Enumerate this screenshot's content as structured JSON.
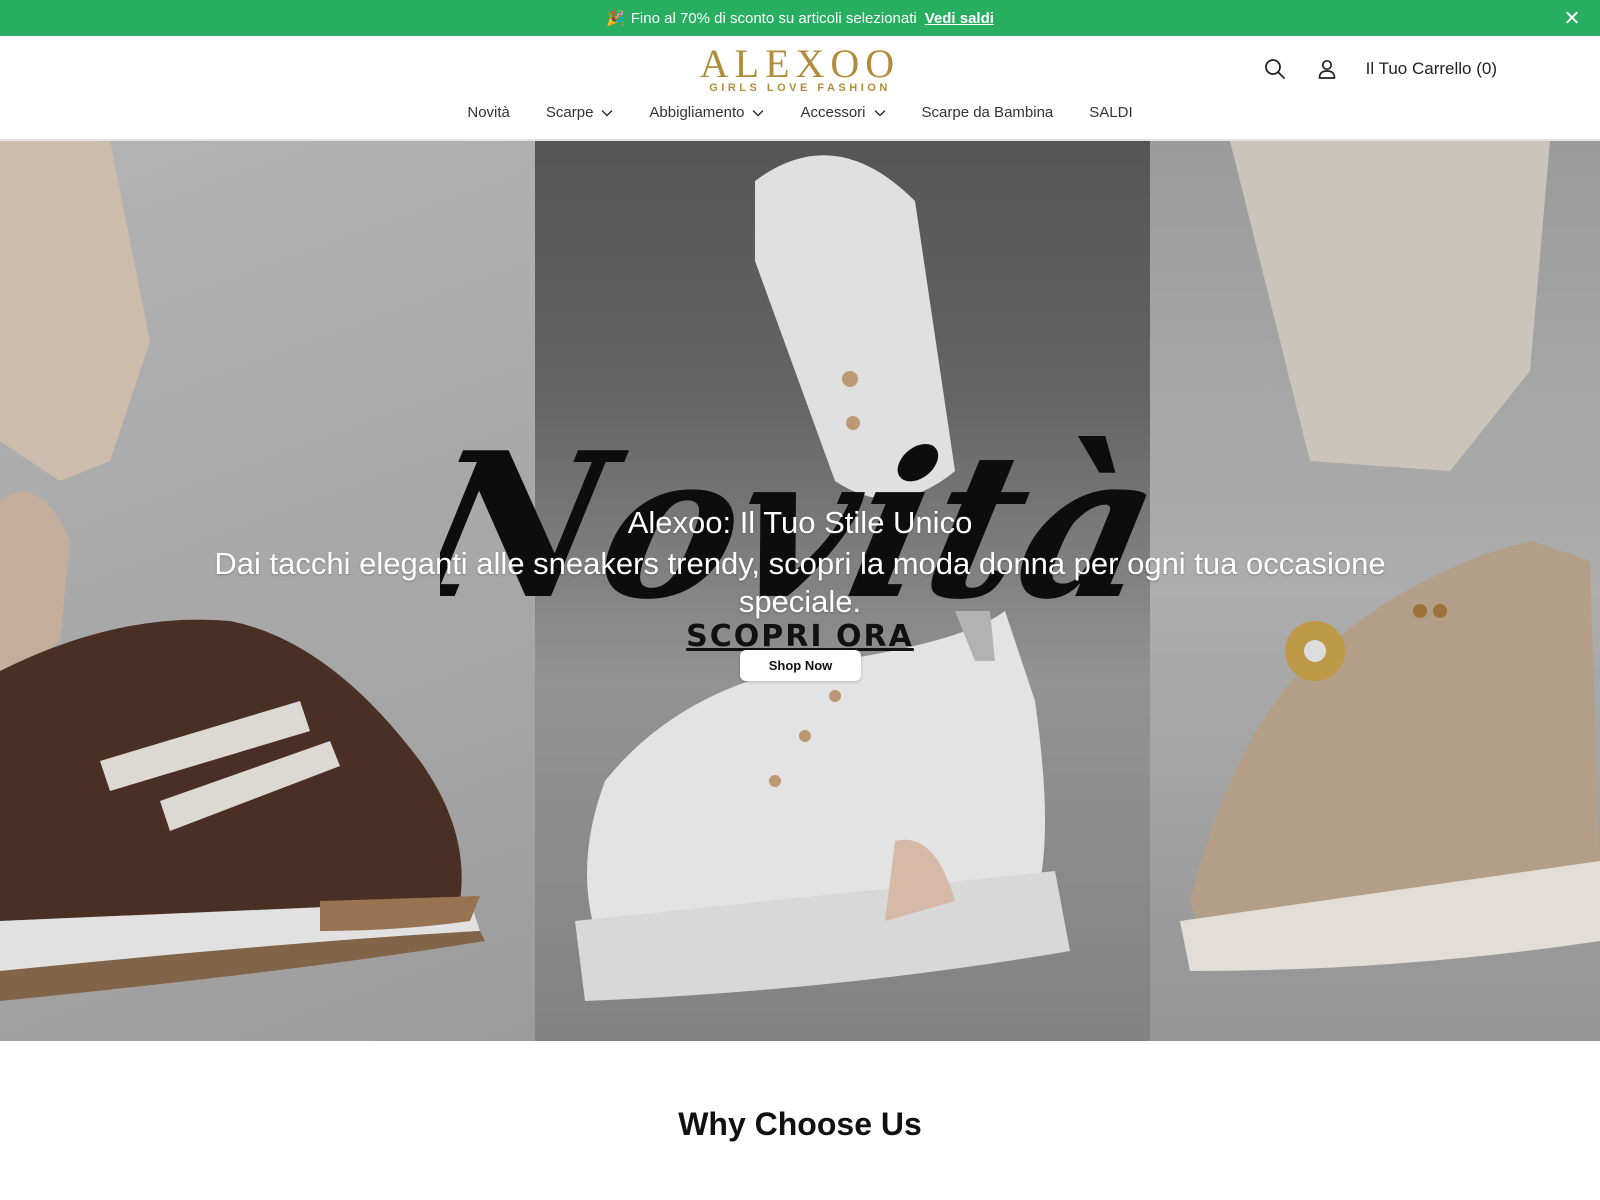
{
  "announcement": {
    "emoji": "🎉",
    "text": "Fino al 70% di sconto su articoli selezionati",
    "link": "Vedi saldi"
  },
  "header": {
    "logo_main": "ALEXOO",
    "logo_sub": "GIRLS LOVE FASHION",
    "cart_label": "Il Tuo Carrello (0)"
  },
  "nav": {
    "items": [
      {
        "label": "Novità"
      },
      {
        "label": "Scarpe"
      },
      {
        "label": "Abbigliamento"
      },
      {
        "label": "Accessori"
      },
      {
        "label": "Scarpe da Bambina"
      },
      {
        "label": "SALDI"
      }
    ]
  },
  "hero": {
    "script_text": "Novità",
    "title": "Alexoo: Il Tuo Stile Unico",
    "subtitle": "Dai tacchi eleganti alle sneakers trendy, scopri la moda donna per ogni tua occasione speciale.",
    "cta_text": "SCOPRI ORA",
    "button": "Shop Now"
  },
  "section": {
    "why_title": "Why Choose Us"
  },
  "colors": {
    "announcement_bg": "#27ae60",
    "brand_gold": "#b08d3c"
  }
}
